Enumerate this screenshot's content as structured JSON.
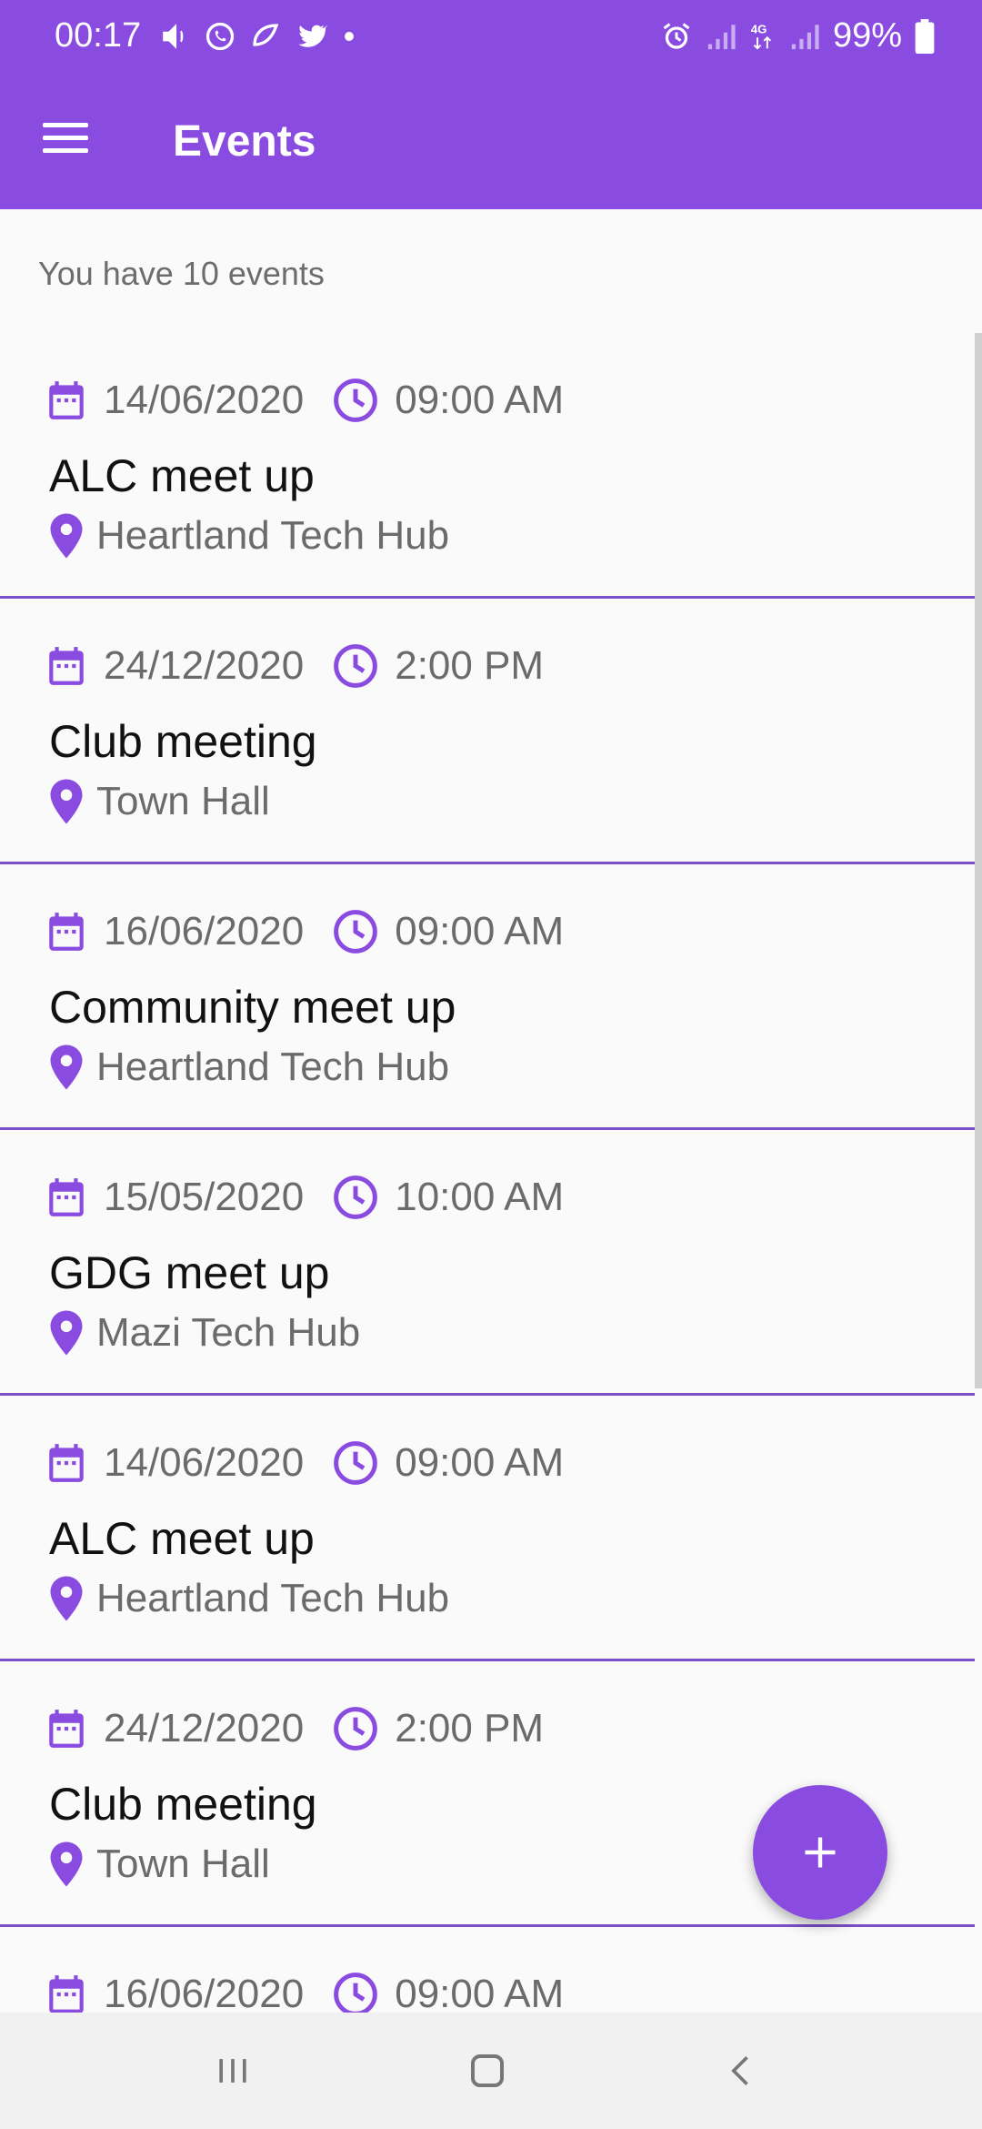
{
  "status_bar": {
    "time": "00:17",
    "battery": "99%",
    "left_icons": [
      "volume-icon",
      "whatsapp-icon",
      "notification-app-icon",
      "twitter-icon",
      "dot-icon"
    ],
    "right_icons": [
      "alarm-icon",
      "signal-icon",
      "4g-icon",
      "signal-icon",
      "battery-icon"
    ]
  },
  "toolbar": {
    "title": "Events",
    "menu_icon": "hamburger-menu-icon"
  },
  "summary": {
    "count_text": "You have 10 events"
  },
  "events": [
    {
      "date": "14/06/2020",
      "time": "09:00 AM",
      "title": "ALC meet up",
      "location": "Heartland Tech Hub"
    },
    {
      "date": "24/12/2020",
      "time": "2:00 PM",
      "title": "Club meeting",
      "location": "Town Hall"
    },
    {
      "date": "16/06/2020",
      "time": "09:00 AM",
      "title": "Community meet up",
      "location": "Heartland Tech Hub"
    },
    {
      "date": "15/05/2020",
      "time": "10:00 AM",
      "title": "GDG meet up",
      "location": "Mazi Tech Hub"
    },
    {
      "date": "14/06/2020",
      "time": "09:00 AM",
      "title": "ALC meet up",
      "location": "Heartland Tech Hub"
    },
    {
      "date": "24/12/2020",
      "time": "2:00 PM",
      "title": "Club meeting",
      "location": "Town Hall"
    },
    {
      "date": "16/06/2020",
      "time": "09:00 AM",
      "title": "",
      "location": ""
    }
  ],
  "fab": {
    "icon": "plus-icon"
  },
  "nav_bar": {
    "icons": [
      "recent-apps-icon",
      "home-icon",
      "back-icon"
    ]
  },
  "colors": {
    "primary": "#8a4be0",
    "divider": "#7b4fc9",
    "text_secondary": "#6b6b6b",
    "background": "#fafafa"
  }
}
